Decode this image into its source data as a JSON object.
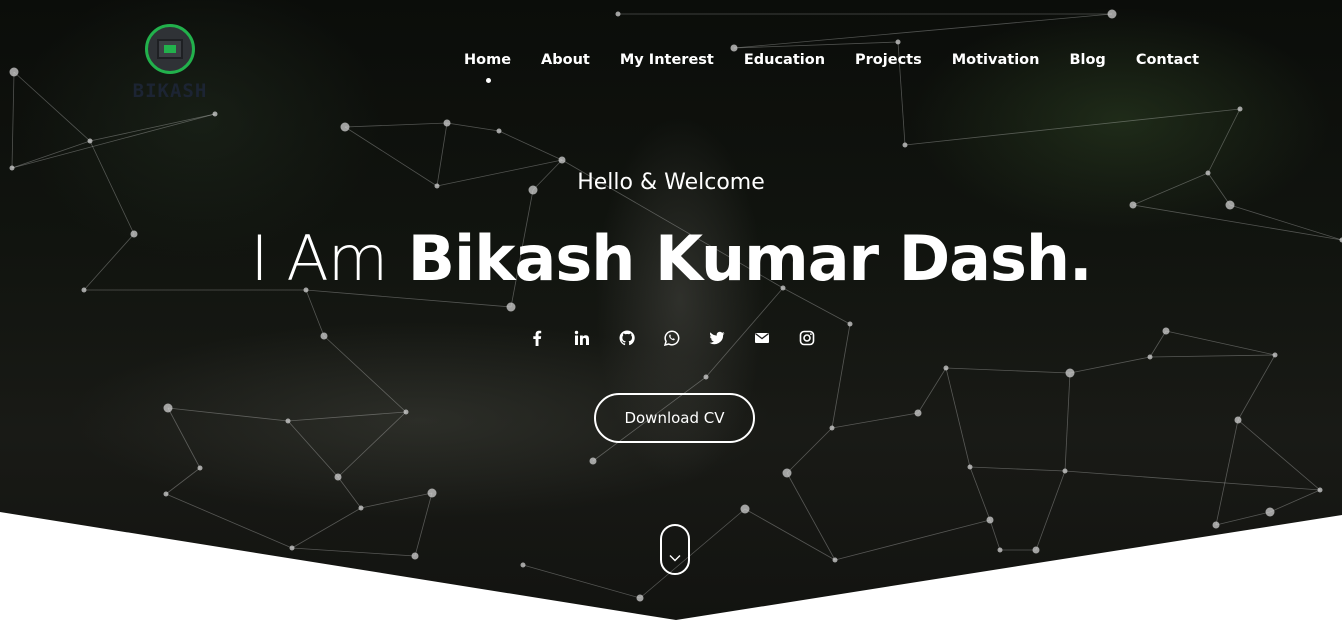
{
  "logo": {
    "text": "BIKASH"
  },
  "nav": {
    "items": [
      {
        "label": "Home",
        "active": true
      },
      {
        "label": "About"
      },
      {
        "label": "My Interest"
      },
      {
        "label": "Education"
      },
      {
        "label": "Projects"
      },
      {
        "label": "Motivation"
      },
      {
        "label": "Blog"
      },
      {
        "label": "Contact"
      }
    ]
  },
  "hero": {
    "greeting": "Hello & Welcome",
    "headline_prefix": "I Am",
    "headline_name": "Bikash Kumar Dash."
  },
  "socials": [
    {
      "icon": "facebook-icon"
    },
    {
      "icon": "linkedin-icon"
    },
    {
      "icon": "github-icon"
    },
    {
      "icon": "whatsapp-icon"
    },
    {
      "icon": "twitter-icon"
    },
    {
      "icon": "email-icon"
    },
    {
      "icon": "instagram-icon"
    }
  ],
  "cta": {
    "download_cv": "Download CV"
  },
  "colors": {
    "accent": "#22b14c",
    "text": "#ffffff",
    "background": "#ffffff"
  }
}
